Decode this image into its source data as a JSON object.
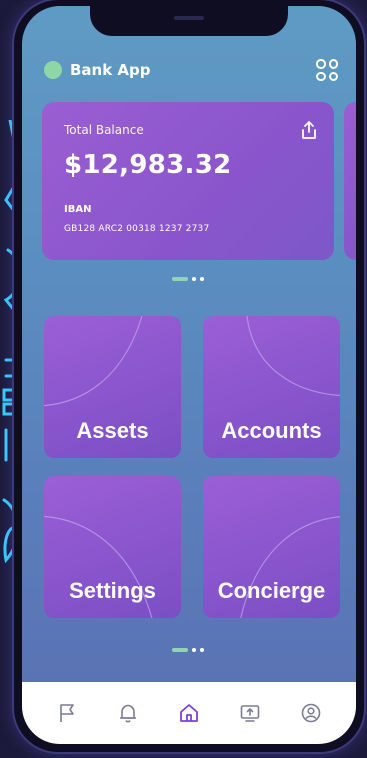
{
  "app": {
    "name": "Bank App"
  },
  "balance_card": {
    "label": "Total Balance",
    "amount": "$12,983.32",
    "iban_label": "IBAN",
    "iban_value": "GB128 ARC2 00318 1237 2737"
  },
  "tiles": [
    {
      "label": "Assets"
    },
    {
      "label": "Accounts"
    },
    {
      "label": "Settings"
    },
    {
      "label": "Concierge"
    }
  ],
  "tabbar": {
    "items": [
      {
        "icon": "flag-icon"
      },
      {
        "icon": "bell-icon"
      },
      {
        "icon": "home-icon",
        "active": true
      },
      {
        "icon": "transfer-icon"
      },
      {
        "icon": "profile-icon"
      }
    ]
  },
  "colors": {
    "accent_green": "#8fd6a6",
    "card_purple": "#8a55cc",
    "active_tab": "#7b3fe0",
    "inactive_tab": "#7c7c96"
  }
}
